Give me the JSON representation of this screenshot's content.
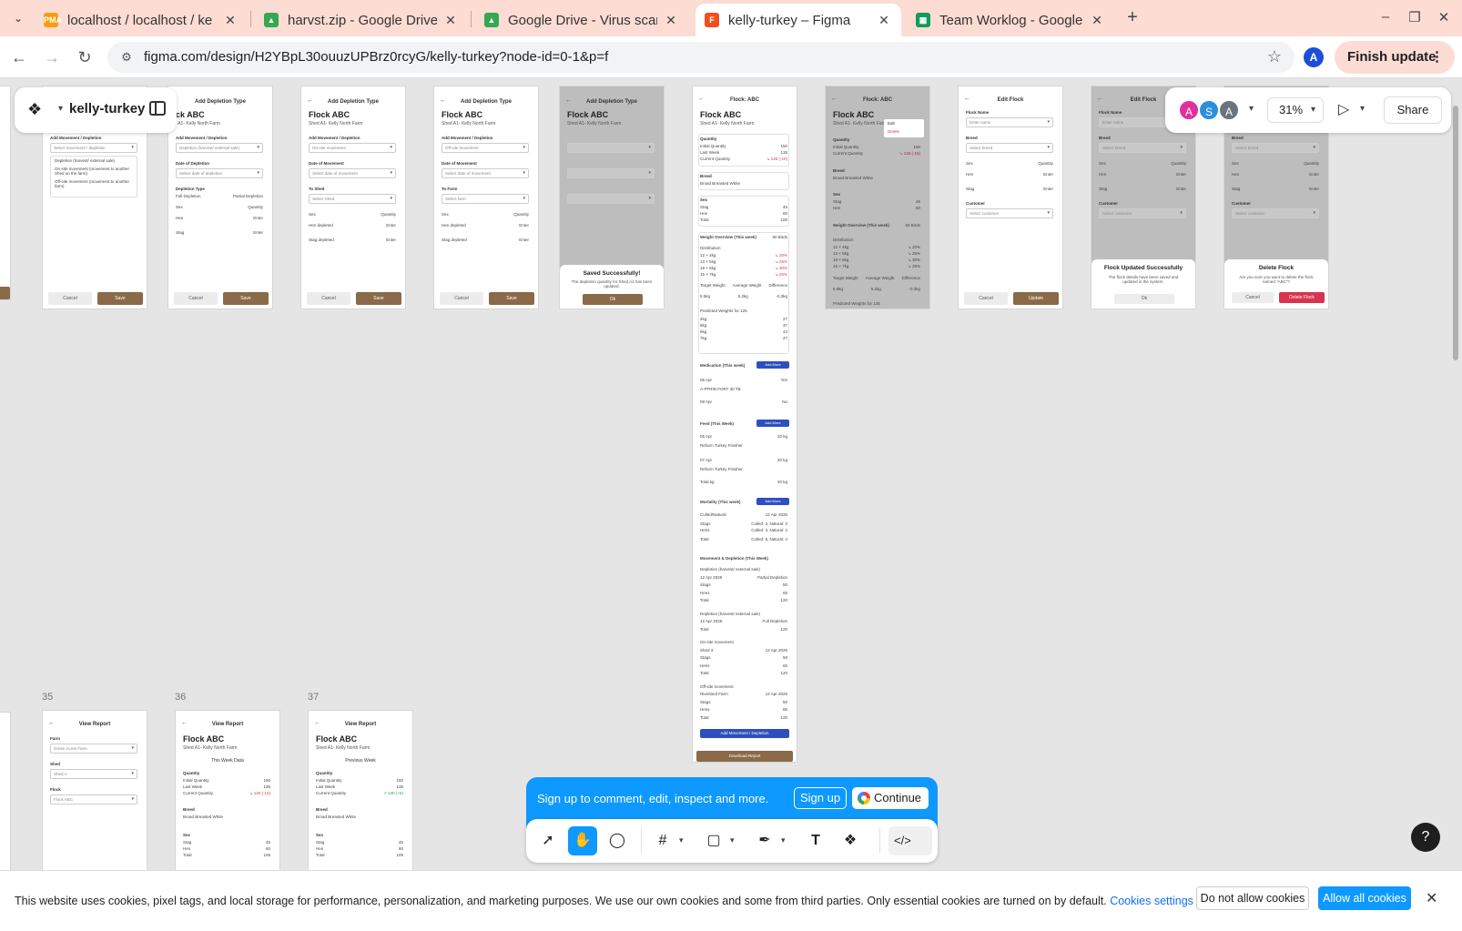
{
  "browser": {
    "tabs": [
      {
        "title": "localhost / localhost / ke",
        "favicon": "phpmyadmin-icon",
        "color": "#f59e0b",
        "glyph": "PMA"
      },
      {
        "title": "harvst.zip - Google Drive",
        "favicon": "google-drive-icon",
        "color": "#34a853",
        "glyph": "▲"
      },
      {
        "title": "Google Drive - Virus scar",
        "favicon": "google-drive-icon",
        "color": "#34a853",
        "glyph": "▲"
      },
      {
        "title": "kelly-turkey – Figma",
        "favicon": "figma-icon",
        "color": "#f24e1e",
        "glyph": "F",
        "active": true
      },
      {
        "title": "Team Worklog - Google S",
        "favicon": "google-sheets-icon",
        "color": "#0f9d58",
        "glyph": "▦"
      }
    ],
    "url": "figma.com/design/H2YBpL30ouuzUPBrz0rcyG/kelly-turkey?node-id=0-1&p=f",
    "profile_initial": "A",
    "finish_update_label": "Finish update"
  },
  "figma": {
    "file_name": "kelly-turkey",
    "avatars": [
      {
        "initial": "A",
        "color": "#e0309b"
      },
      {
        "initial": "S",
        "color": "#2d8ee0"
      },
      {
        "initial": "A",
        "color": "#6b7280"
      }
    ],
    "zoom": "31%",
    "share_label": "Share",
    "signup_text": "Sign up to comment, edit, inspect and more.",
    "signup_label": "Sign up",
    "continue_label": "Continue",
    "help_label": "?"
  },
  "frames": {
    "f1": {
      "list_label": "Add Movement / Depletion",
      "select": "Select movement / depletion",
      "options": [
        "Depletion (harvest/ external sale)",
        "On-site movement (movement to another Shed on the farm)",
        "Off-site movement (movement to another farm)"
      ],
      "cancel": "Cancel",
      "save": "Save"
    },
    "f2": {
      "header": "Add Depletion Type",
      "title": "ck ABC",
      "sub": "l A1- Kelly North Farm",
      "l1": "Add Movement / Depletion",
      "s1": "Depletion (harvest/ external sale)",
      "l2": "Date of Depletion",
      "s2": "Select date of depletion",
      "l3": "Depletion Type",
      "r1": "Full Depletion",
      "r2": "Partial Depletion",
      "c1": "Sex",
      "c2": "Quantity",
      "hen": "Hen",
      "stag": "Stag",
      "enter": "Enter",
      "cancel": "Cancel",
      "save": "Save"
    },
    "f3": {
      "header": "Add Depletion Type",
      "title": "Flock ABC",
      "sub": "Shed A1- Kelly North Farm",
      "l1": "Add Movement / Depletion",
      "s1": "On-site movement",
      "l2": "Date of Movement",
      "s2": "Select date of movement",
      "l3": "To Shed",
      "s3": "Select Shed",
      "c1": "Sex",
      "c2": "Quantity",
      "hen": "Hen depleted",
      "stag": "Stag depleted",
      "enter": "Enter",
      "cancel": "Cancel",
      "save": "Save"
    },
    "f4": {
      "header": "Add Depletion Type",
      "title": "Flock ABC",
      "sub": "Shed A1- Kelly North Farm",
      "l1": "Add Movement / Depletion",
      "s1": "Off-site movement",
      "l2": "Date of Movement",
      "s2": "Select date of movement",
      "l3": "To Farm",
      "s3": "Select farm",
      "c1": "Sex",
      "c2": "Quantity",
      "hen": "Hen depleted",
      "stag": "Stag depleted",
      "enter": "Enter",
      "cancel": "Cancel",
      "save": "Save"
    },
    "f5": {
      "header": "Add Depletion Type",
      "title": "Flock ABC",
      "sub": "Shed A1- Kelly North Farm",
      "dialog_title": "Saved Successfully!",
      "dialog_msg": "The depletion quantity for Shed A1 has been updated.",
      "ok": "Ok"
    },
    "f6": {
      "header": "Flock: ABC",
      "title": "Flock ABC",
      "sub": "Shed A1- Kelly North Farm",
      "quantity": "Quantity",
      "q_rows": [
        [
          "Initial Quantity",
          "150"
        ],
        [
          "Last Week",
          "135"
        ],
        [
          "Current Quantity",
          "↘ 125 (-10)"
        ]
      ],
      "breed": "Breed",
      "breed_value": "Broad Breasted White",
      "sex": "Sex",
      "sex_rows": [
        [
          "Stag",
          "45"
        ],
        [
          "Hen",
          "60"
        ],
        [
          "Total",
          "100"
        ]
      ],
      "weight": "Weight Overview (This week)",
      "weight_birds": "60 Birds",
      "distribution": "Distribution",
      "dist_rows": [
        [
          "12 × 4kg",
          "↘ 20%"
        ],
        [
          "13 × 5kg",
          "↘ 25%"
        ],
        [
          "18 × 6kg",
          "↘ 30%"
        ],
        [
          "15 × 7kg",
          "↘ 25%"
        ]
      ],
      "target": "Target Weight",
      "target_v": "5.5kg",
      "avg": "Average Weight",
      "avg_v": "5.2kg",
      "diff": "Difference",
      "diff_v": "-0.3kg",
      "predicted": "Predicted Weights for 125",
      "pred_rows": [
        [
          "4kg",
          "27"
        ],
        [
          "5kg",
          "37"
        ],
        [
          "6kg",
          "44"
        ],
        [
          "7kg",
          "27"
        ]
      ],
      "medication": "Medication (This week)",
      "add_more": "Add More",
      "med_rows": [
        [
          "06 Apr",
          "Yes"
        ],
        [
          "A-PFRIN FORT 30 TB",
          ""
        ],
        [
          "09 Apr",
          "No"
        ]
      ],
      "feed": "Feed (This Week)",
      "feed_rows": [
        [
          "06 Apr",
          "20 kg"
        ],
        [
          "Reform Turkey Finisher",
          ""
        ],
        [
          "07 Apr",
          "20 kg"
        ],
        [
          "Reform Turkey Finisher",
          ""
        ],
        [
          "Total kg",
          "40 kg"
        ]
      ],
      "mortality": "Mortality (This week)",
      "mort_rows": [
        [
          "Culled/Natural",
          "12 Apr 2025"
        ],
        [
          "Stags",
          "Culled: 3, Natural: 2"
        ],
        [
          "Hens",
          "Culled: 3, Natural: 2"
        ],
        [
          "Total",
          "Culled: 6, Natural: 4"
        ]
      ],
      "movement": "Movement & Depletion (This Week)",
      "mv_rows": [
        [
          "Depletion (harvest/ external sale)",
          ""
        ],
        [
          "12 Apr 2025",
          "Partial Depletion"
        ],
        [
          "Stags",
          "50"
        ],
        [
          "Hens",
          "65"
        ],
        [
          "Total",
          "120"
        ],
        [
          "Depletion (harvest/ external sale)",
          ""
        ],
        [
          "12 Apr 2025",
          "Full Depletion"
        ],
        [
          "Total",
          "120"
        ],
        [
          "On-site movement",
          ""
        ],
        [
          "Shed 3",
          "12 Apr 2025"
        ],
        [
          "Stags",
          "50"
        ],
        [
          "Hens",
          "65"
        ],
        [
          "Total",
          "120"
        ],
        [
          "Off-site movement",
          ""
        ],
        [
          "Riverland Farm",
          "12 Apr 2025"
        ],
        [
          "Stags",
          "50"
        ],
        [
          "Hens",
          "65"
        ],
        [
          "Total",
          "120"
        ]
      ],
      "add_movement": "Add Movement / Depletion",
      "download": "Download Report"
    },
    "f7": {
      "header": "Flock: ABC",
      "title": "Flock ABC",
      "sub": "Shed A1- Kelly North Farm",
      "menu_edit": "Edit",
      "menu_delete": "Delete",
      "quantity": "Quantity",
      "q_rows": [
        [
          "Initial Quantity",
          "150"
        ],
        [
          "Current Quantity",
          "↘ 135 (-15)"
        ]
      ],
      "breed": "Breed",
      "breed_value": "Broad Breasted White",
      "sex": "Sex",
      "sex_rows": [
        [
          "Stag",
          "45"
        ],
        [
          "Hen",
          "60"
        ]
      ],
      "weight": "Weight Overview (This week)",
      "weight_birds": "60 Birds",
      "distribution": "Distribution",
      "dist_rows": [
        [
          "12 × 4kg",
          "↘ 20%"
        ],
        [
          "13 × 5kg",
          "↘ 25%"
        ],
        [
          "18 × 6kg",
          "↘ 30%"
        ],
        [
          "15 × 7kg",
          "↘ 25%"
        ]
      ],
      "target": "Target Weight",
      "target_v": "5.5kg",
      "avg": "Average Weight",
      "avg_v": "5.2kg",
      "diff": "Difference",
      "diff_v": "-0.3kg",
      "predicted": "Predicted Weights for 135"
    },
    "f8": {
      "header": "Edit Flock",
      "l1": "Flock Name",
      "s1": "Enter name",
      "l2": "Breed",
      "s2": "Select breed",
      "c1": "Sex",
      "c2": "Quantity",
      "hen": "Hen",
      "stag": "Stag",
      "enter": "Enter",
      "l3": "Customer",
      "s3": "Select customer",
      "cancel": "Cancel",
      "update": "Update"
    },
    "f9": {
      "header": "Edit Flock",
      "l1": "Flock Name",
      "s1": "Enter name",
      "l2": "Breed",
      "s2": "Select breed",
      "c1": "Sex",
      "c2": "Quantity",
      "hen": "Hen",
      "stag": "Stag",
      "enter": "Enter",
      "l3": "Customer",
      "s3": "Select customer",
      "dialog_title": "Flock Updated Successfully",
      "dialog_msg": "The flock details have been saved and updated in the system.",
      "ok": "Ok"
    },
    "f10": {
      "l2": "Breed",
      "s2": "Select breed",
      "c1": "Sex",
      "c2": "Quantity",
      "hen": "Hen",
      "stag": "Stag",
      "enter": "Enter",
      "l3": "Customer",
      "s3": "Select customer",
      "dialog_title": "Delete Flock",
      "dialog_msg": "Are you sure you want to delete the flock named \"ABC\"?",
      "cancel": "Cancel",
      "delete": "Delete Flock"
    },
    "f35": {
      "num": "35",
      "header": "View Report",
      "l1": "Farm",
      "s1": "Green Acres Farm",
      "l2": "Shed",
      "s2": "Shed A",
      "l3": "Flock",
      "s3": "Flock ABC"
    },
    "f36": {
      "num": "36",
      "header": "View Report",
      "title": "Flock ABC",
      "sub": "Shed A1- Kelly North Farm",
      "week": "This Week Data",
      "quantity": "Quantity",
      "q_rows": [
        [
          "Initial Quantity",
          "150"
        ],
        [
          "Last Week",
          "135"
        ],
        [
          "Current Quantity",
          "↘ 140 (-10)"
        ]
      ],
      "breed": "Breed",
      "breed_value": "Broad Breasted White",
      "sex": "Sex",
      "sex_rows": [
        [
          "Stag",
          "45"
        ],
        [
          "Hen",
          "60"
        ],
        [
          "Total",
          "105"
        ]
      ]
    },
    "f37": {
      "num": "37",
      "header": "View Report",
      "title": "Flock ABC",
      "sub": "Shed A1- Kelly North Farm",
      "week": "Previous Week",
      "quantity": "Quantity",
      "q_rows": [
        [
          "Initial Quantity",
          "150"
        ],
        [
          "Last Week",
          "135"
        ],
        [
          "Current Quantity",
          "↗ 140 (+5)"
        ]
      ],
      "breed": "Breed",
      "breed_value": "Broad Breasted White",
      "sex": "Sex",
      "sex_rows": [
        [
          "Stag",
          "45"
        ],
        [
          "Hen",
          "60"
        ],
        [
          "Total",
          "105"
        ]
      ]
    }
  },
  "cookie": {
    "text": "This website uses cookies, pixel tags, and local storage for performance, personalization, and marketing purposes. We use our own cookies and some from third parties. Only essential cookies are turned on by default.",
    "settings_link": "Cookies settings",
    "deny_label": "Do not allow cookies",
    "allow_label": "Allow all cookies"
  }
}
